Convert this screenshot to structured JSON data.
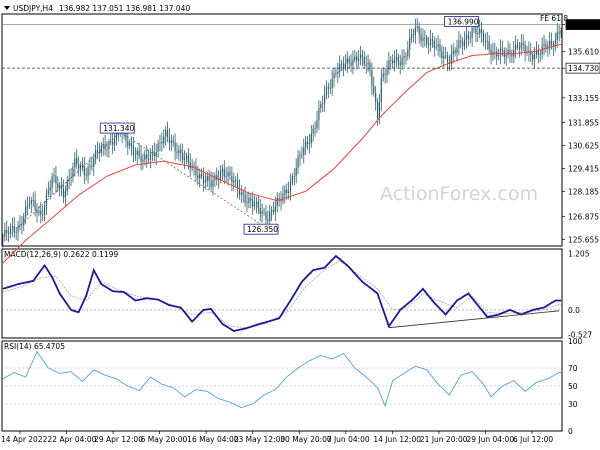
{
  "header": {
    "symbol": "USDJPY,H4",
    "ohlc": "136.982 137.051 136.981 137.040"
  },
  "watermark": "ActionForex.com",
  "colors": {
    "candle": "#2f5f6f",
    "sma": "#e8443a",
    "macd": "#1a1a99",
    "signal": "#b0b0b0",
    "rsi": "#4da3e0",
    "hline": "#333333",
    "annot_border": "#1a1a99"
  },
  "chart_data": [
    {
      "type": "candlestick",
      "name": "price",
      "ylim": [
        125.3,
        137.6
      ],
      "y_ticks": [
        "137.040",
        "135.610",
        "134.730",
        "133.155",
        "131.855",
        "130.625",
        "129.415",
        "128.185",
        "126.875",
        "125.655"
      ],
      "x_ticks": [
        "14 Apr 2022",
        "22 Apr 04:00",
        "29 Apr 12:00",
        "6 May 20:00",
        "16 May 04:00",
        "23 May 12:00",
        "30 May 20:00",
        "7 Jun 04:00",
        "14 Jun 12:00",
        "21 Jun 20:00",
        "29 Jun 04:00",
        "6 Jul 12:00"
      ],
      "price_path": [
        [
          0,
          125.8
        ],
        [
          8,
          126.3
        ],
        [
          14,
          127.6
        ],
        [
          20,
          127.0
        ],
        [
          26,
          128.8
        ],
        [
          32,
          128.2
        ],
        [
          38,
          129.6
        ],
        [
          44,
          129.3
        ],
        [
          50,
          130.2
        ],
        [
          56,
          130.8
        ],
        [
          62,
          131.3
        ],
        [
          68,
          130.6
        ],
        [
          74,
          129.7
        ],
        [
          80,
          130.4
        ],
        [
          86,
          131.1
        ],
        [
          92,
          130.5
        ],
        [
          98,
          129.6
        ],
        [
          104,
          129.1
        ],
        [
          110,
          128.5
        ],
        [
          116,
          129.4
        ],
        [
          122,
          128.6
        ],
        [
          128,
          127.9
        ],
        [
          134,
          127.3
        ],
        [
          140,
          126.9
        ],
        [
          146,
          127.6
        ],
        [
          152,
          128.7
        ],
        [
          158,
          130.2
        ],
        [
          164,
          131.5
        ],
        [
          170,
          133.2
        ],
        [
          176,
          134.7
        ],
        [
          182,
          134.9
        ],
        [
          188,
          135.5
        ],
        [
          194,
          134.5
        ],
        [
          198,
          132.3
        ],
        [
          200,
          134.2
        ],
        [
          206,
          135.1
        ],
        [
          212,
          135.3
        ],
        [
          218,
          136.8
        ],
        [
          224,
          136.2
        ],
        [
          230,
          135.7
        ],
        [
          236,
          135.2
        ],
        [
          242,
          136.0
        ],
        [
          248,
          136.8
        ],
        [
          254,
          136.3
        ],
        [
          260,
          135.5
        ],
        [
          266,
          135.4
        ],
        [
          272,
          136.0
        ],
        [
          278,
          135.4
        ],
        [
          284,
          135.7
        ],
        [
          290,
          135.9
        ],
        [
          295,
          137.0
        ]
      ],
      "sma": [
        [
          0,
          124.4
        ],
        [
          12,
          125.6
        ],
        [
          25,
          126.7
        ],
        [
          40,
          128.0
        ],
        [
          55,
          129.0
        ],
        [
          70,
          129.6
        ],
        [
          85,
          129.8
        ],
        [
          100,
          129.5
        ],
        [
          115,
          128.8
        ],
        [
          130,
          128.1
        ],
        [
          145,
          127.7
        ],
        [
          160,
          128.2
        ],
        [
          175,
          129.4
        ],
        [
          190,
          131.0
        ],
        [
          200,
          132.2
        ],
        [
          212,
          133.4
        ],
        [
          224,
          134.5
        ],
        [
          236,
          135.0
        ],
        [
          248,
          135.4
        ],
        [
          260,
          135.5
        ],
        [
          270,
          135.5
        ],
        [
          280,
          135.6
        ],
        [
          288,
          135.8
        ],
        [
          295,
          136.0
        ]
      ],
      "annotations": [
        {
          "label": "136.990",
          "x": 244,
          "y": 136.99
        },
        {
          "label": "131.340",
          "x": 62,
          "y": 131.34
        },
        {
          "label": "126.350",
          "x": 138,
          "y": 126.35
        }
      ],
      "fe_label": "FE 61.8",
      "level_line": {
        "value": 134.73,
        "label": "134.730"
      },
      "last_price": {
        "value": 137.04,
        "label": "137.040"
      }
    },
    {
      "type": "line",
      "name": "macd",
      "title": "MACD(12,26,9) 0.2622 0.1199",
      "ylim": [
        -0.6,
        1.3
      ],
      "y_ticks": [
        "1.205",
        "0.0",
        "-0.527"
      ],
      "macd": [
        [
          0,
          0.45
        ],
        [
          8,
          0.55
        ],
        [
          16,
          0.62
        ],
        [
          22,
          0.95
        ],
        [
          26,
          0.7
        ],
        [
          30,
          0.35
        ],
        [
          36,
          0.0
        ],
        [
          40,
          -0.05
        ],
        [
          44,
          0.3
        ],
        [
          48,
          0.85
        ],
        [
          52,
          0.55
        ],
        [
          58,
          0.4
        ],
        [
          64,
          0.38
        ],
        [
          70,
          0.2
        ],
        [
          76,
          0.25
        ],
        [
          82,
          0.22
        ],
        [
          88,
          0.1
        ],
        [
          94,
          0.05
        ],
        [
          100,
          -0.25
        ],
        [
          106,
          0.0
        ],
        [
          110,
          0.02
        ],
        [
          116,
          -0.3
        ],
        [
          122,
          -0.45
        ],
        [
          128,
          -0.4
        ],
        [
          134,
          -0.32
        ],
        [
          140,
          -0.25
        ],
        [
          146,
          -0.18
        ],
        [
          152,
          0.2
        ],
        [
          158,
          0.6
        ],
        [
          164,
          0.85
        ],
        [
          170,
          0.9
        ],
        [
          176,
          1.15
        ],
        [
          182,
          0.95
        ],
        [
          190,
          0.6
        ],
        [
          198,
          0.35
        ],
        [
          204,
          -0.35
        ],
        [
          210,
          0.0
        ],
        [
          216,
          0.2
        ],
        [
          222,
          0.45
        ],
        [
          228,
          0.15
        ],
        [
          234,
          -0.1
        ],
        [
          240,
          0.2
        ],
        [
          246,
          0.35
        ],
        [
          252,
          0.05
        ],
        [
          256,
          -0.15
        ],
        [
          262,
          -0.1
        ],
        [
          268,
          0.0
        ],
        [
          274,
          -0.1
        ],
        [
          280,
          0.0
        ],
        [
          286,
          0.05
        ],
        [
          292,
          0.2
        ]
      ],
      "signal": [
        [
          0,
          0.38
        ],
        [
          10,
          0.5
        ],
        [
          20,
          0.68
        ],
        [
          28,
          0.72
        ],
        [
          36,
          0.3
        ],
        [
          44,
          0.2
        ],
        [
          52,
          0.6
        ],
        [
          60,
          0.45
        ],
        [
          70,
          0.3
        ],
        [
          80,
          0.23
        ],
        [
          90,
          0.1
        ],
        [
          100,
          -0.1
        ],
        [
          110,
          -0.05
        ],
        [
          120,
          -0.35
        ],
        [
          130,
          -0.38
        ],
        [
          140,
          -0.28
        ],
        [
          150,
          -0.05
        ],
        [
          160,
          0.5
        ],
        [
          170,
          0.85
        ],
        [
          178,
          1.05
        ],
        [
          188,
          0.75
        ],
        [
          198,
          0.45
        ],
        [
          206,
          0.0
        ],
        [
          214,
          0.05
        ],
        [
          222,
          0.35
        ],
        [
          230,
          0.2
        ],
        [
          240,
          0.05
        ],
        [
          248,
          0.3
        ],
        [
          256,
          -0.05
        ],
        [
          266,
          -0.08
        ],
        [
          276,
          -0.05
        ],
        [
          286,
          0.0
        ],
        [
          294,
          0.12
        ]
      ],
      "trendline": [
        [
          204,
          -0.38
        ],
        [
          294,
          -0.02
        ]
      ]
    },
    {
      "type": "line",
      "name": "rsi",
      "title": "RSI(14) 65.4705",
      "ylim": [
        0,
        100
      ],
      "y_ticks": [
        "100",
        "70",
        "50",
        "30",
        "0"
      ],
      "rsi": [
        [
          0,
          58
        ],
        [
          6,
          65
        ],
        [
          12,
          60
        ],
        [
          18,
          88
        ],
        [
          24,
          70
        ],
        [
          30,
          64
        ],
        [
          36,
          66
        ],
        [
          42,
          55
        ],
        [
          48,
          68
        ],
        [
          54,
          62
        ],
        [
          60,
          58
        ],
        [
          66,
          50
        ],
        [
          72,
          45
        ],
        [
          78,
          60
        ],
        [
          84,
          52
        ],
        [
          90,
          48
        ],
        [
          96,
          38
        ],
        [
          102,
          46
        ],
        [
          108,
          44
        ],
        [
          114,
          36
        ],
        [
          120,
          32
        ],
        [
          126,
          26
        ],
        [
          132,
          30
        ],
        [
          138,
          40
        ],
        [
          144,
          46
        ],
        [
          150,
          60
        ],
        [
          156,
          70
        ],
        [
          162,
          78
        ],
        [
          168,
          84
        ],
        [
          174,
          80
        ],
        [
          180,
          86
        ],
        [
          186,
          70
        ],
        [
          192,
          60
        ],
        [
          198,
          48
        ],
        [
          202,
          28
        ],
        [
          206,
          56
        ],
        [
          212,
          64
        ],
        [
          218,
          72
        ],
        [
          224,
          68
        ],
        [
          230,
          52
        ],
        [
          236,
          40
        ],
        [
          242,
          62
        ],
        [
          248,
          66
        ],
        [
          254,
          52
        ],
        [
          258,
          38
        ],
        [
          264,
          50
        ],
        [
          270,
          56
        ],
        [
          276,
          44
        ],
        [
          282,
          54
        ],
        [
          288,
          58
        ],
        [
          294,
          65
        ]
      ]
    }
  ]
}
